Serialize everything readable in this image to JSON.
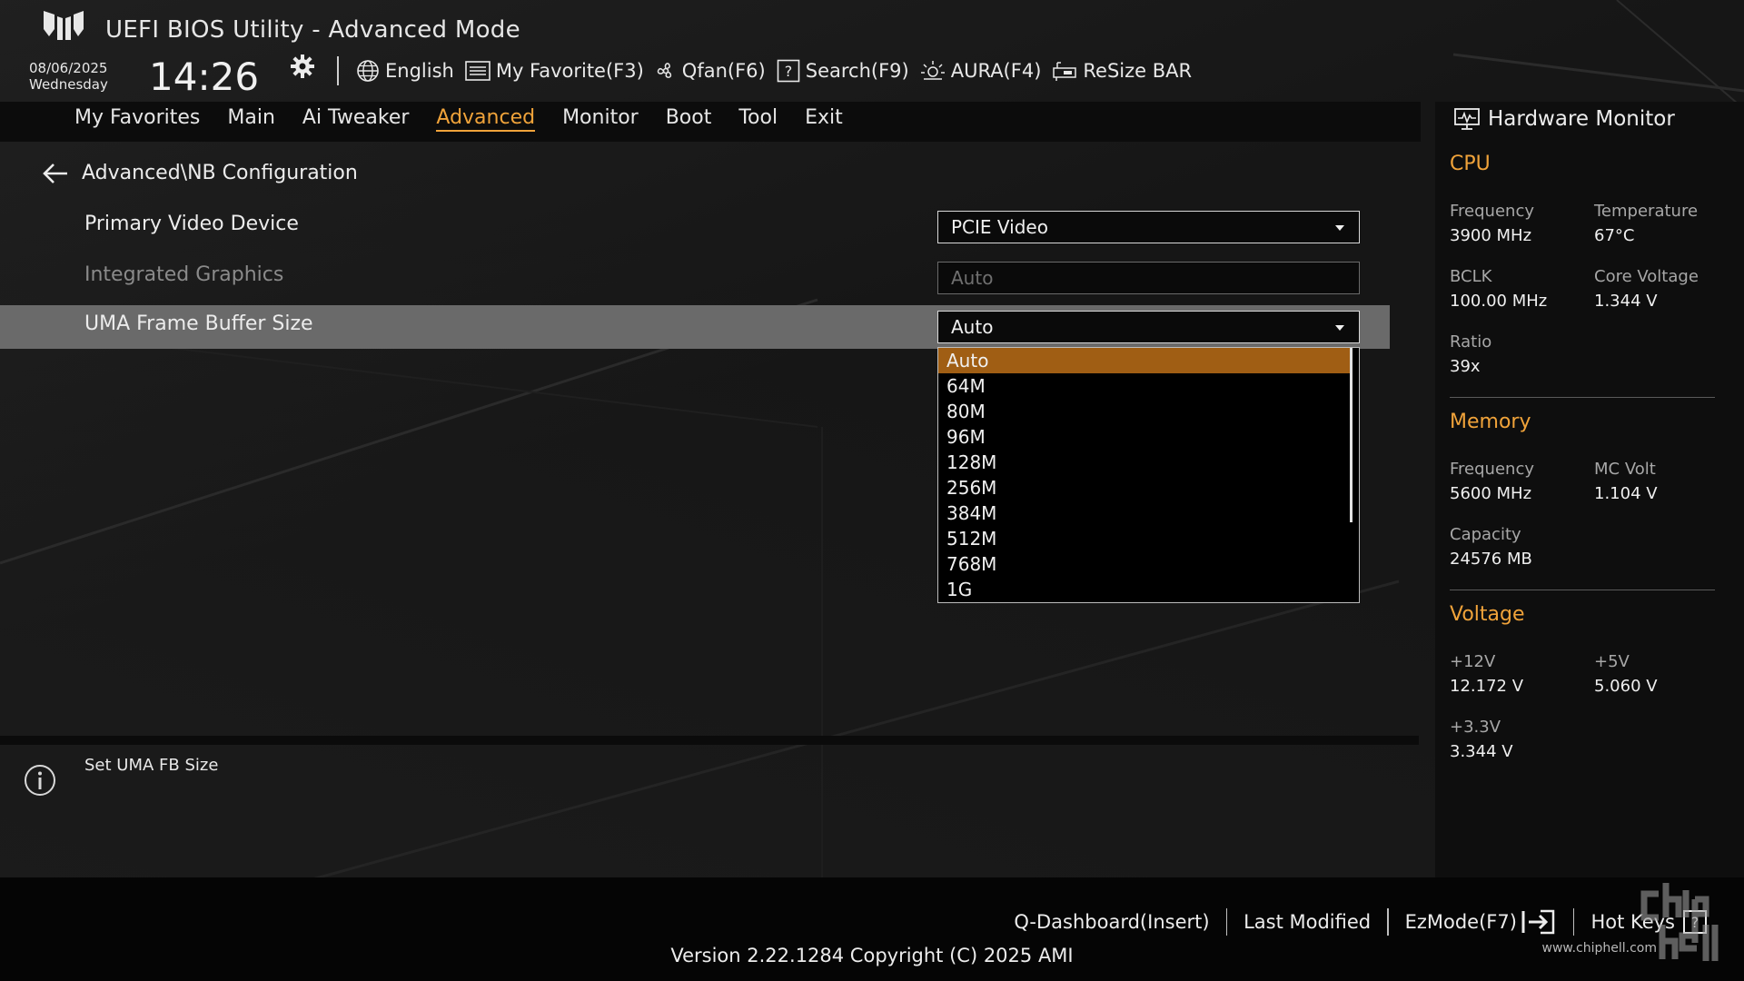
{
  "header": {
    "title": "UEFI BIOS Utility - Advanced Mode",
    "date": "08/06/2025",
    "weekday": "Wednesday",
    "time": "14:26",
    "tools": [
      {
        "label": "English",
        "icon": "globe-icon"
      },
      {
        "label": "My Favorite(F3)",
        "icon": "favorite-list-icon"
      },
      {
        "label": "Qfan(F6)",
        "icon": "fan-icon"
      },
      {
        "label": "Search(F9)",
        "icon": "search-help-icon"
      },
      {
        "label": "AURA(F4)",
        "icon": "aura-light-icon"
      },
      {
        "label": "ReSize BAR",
        "icon": "resize-bar-icon"
      }
    ]
  },
  "menu": {
    "items": [
      "My Favorites",
      "Main",
      "Ai Tweaker",
      "Advanced",
      "Monitor",
      "Boot",
      "Tool",
      "Exit"
    ],
    "active": "Advanced"
  },
  "page": {
    "breadcrumb": "Advanced\\NB Configuration",
    "settings": [
      {
        "label": "Primary Video Device",
        "value": "PCIE Video",
        "state": "enabled"
      },
      {
        "label": "Integrated Graphics",
        "value": "Auto",
        "state": "disabled"
      },
      {
        "label": "UMA Frame Buffer Size",
        "value": "Auto",
        "state": "selected"
      }
    ],
    "dropdown_options": [
      "Auto",
      "64M",
      "80M",
      "96M",
      "128M",
      "256M",
      "384M",
      "512M",
      "768M",
      "1G"
    ],
    "dropdown_highlight": "Auto"
  },
  "help": {
    "text": "Set UMA FB Size"
  },
  "hardware_monitor": {
    "title": "Hardware Monitor",
    "cpu": {
      "heading": "CPU",
      "frequency_label": "Frequency",
      "frequency": "3900 MHz",
      "temperature_label": "Temperature",
      "temperature": "67°C",
      "bclk_label": "BCLK",
      "bclk": "100.00 MHz",
      "core_voltage_label": "Core Voltage",
      "core_voltage": "1.344 V",
      "ratio_label": "Ratio",
      "ratio": "39x"
    },
    "memory": {
      "heading": "Memory",
      "frequency_label": "Frequency",
      "frequency": "5600 MHz",
      "mc_volt_label": "MC Volt",
      "mc_volt": "1.104 V",
      "capacity_label": "Capacity",
      "capacity": "24576 MB"
    },
    "voltage": {
      "heading": "Voltage",
      "v12_label": "+12V",
      "v12": "12.172 V",
      "v5_label": "+5V",
      "v5": "5.060 V",
      "v33_label": "+3.3V",
      "v33": "3.344 V"
    }
  },
  "footer": {
    "links": [
      "Q-Dashboard(Insert)",
      "Last Modified",
      "EzMode(F7)",
      "Hot Keys"
    ],
    "version": "Version 2.22.1284 Copyright (C) 2025 AMI",
    "watermark_url": "www.chiphell.com"
  },
  "colors": {
    "accent": "#f0a33a",
    "highlight": "#a05e14",
    "selected_row": "#6a6a6a"
  }
}
